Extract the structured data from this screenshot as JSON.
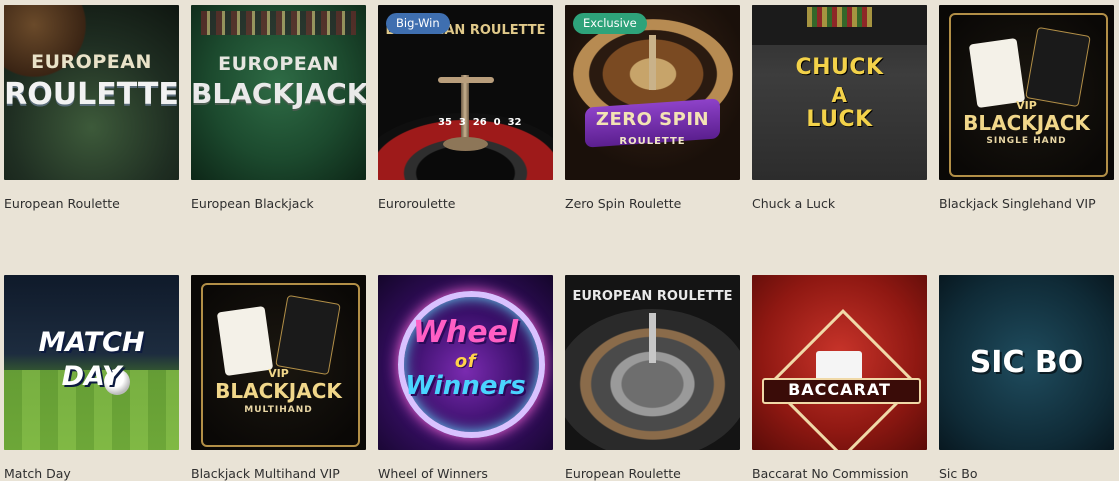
{
  "games": [
    {
      "title": "European Roulette",
      "art": [
        "EUROPEAN",
        "ROULETTE"
      ],
      "badge": ""
    },
    {
      "title": "European Blackjack",
      "art": [
        "EUROPEAN",
        "BLACKJACK"
      ],
      "badge": ""
    },
    {
      "title": "Euroroulette",
      "art": [
        "EUROPEAN ROULETTE",
        "35  3  26  0  32"
      ],
      "badge": "Big-Win"
    },
    {
      "title": "Zero Spin Roulette",
      "art": [
        "ZERO SPIN",
        "ROULETTE"
      ],
      "badge": "Exclusive"
    },
    {
      "title": "Chuck a Luck",
      "art": [
        "CHUCK",
        "A",
        "LUCK"
      ],
      "badge": ""
    },
    {
      "title": "Blackjack Singlehand VIP",
      "art": [
        "VIP",
        "BLACKJACK",
        "SINGLE HAND"
      ],
      "badge": ""
    },
    {
      "title": "Match Day",
      "art": [
        "MATCH",
        "DAY"
      ],
      "badge": ""
    },
    {
      "title": "Blackjack Multihand VIP",
      "art": [
        "VIP",
        "BLACKJACK",
        "MULTIHAND"
      ],
      "badge": ""
    },
    {
      "title": "Wheel of Winners",
      "art": [
        "Wheel",
        "of",
        "Winners"
      ],
      "badge": ""
    },
    {
      "title": "European Roulette",
      "art": [
        "EUROPEAN ROULETTE"
      ],
      "badge": ""
    },
    {
      "title": "Baccarat No Commission",
      "art": [
        "BACCARAT"
      ],
      "badge": ""
    },
    {
      "title": "Sic Bo",
      "art": [
        "SIC BO"
      ],
      "badge": ""
    }
  ],
  "colors": {
    "background": "#e9e3d6",
    "badge_bigwin": "#3f6fb0",
    "badge_exclusive": "#2ea37a"
  }
}
